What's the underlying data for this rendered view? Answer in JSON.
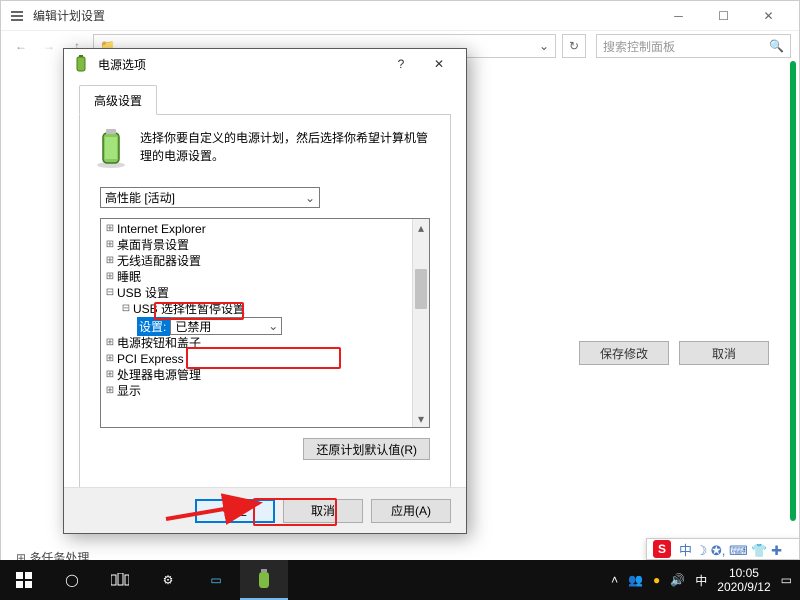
{
  "parent": {
    "title": "编辑计划设置",
    "search_placeholder": "搜索控制面板",
    "save_btn": "保存修改",
    "cancel_btn": "取消",
    "bottom_item": "多任务处理"
  },
  "dialog": {
    "title": "电源选项",
    "tab": "高级设置",
    "description": "选择你要自定义的电源计划，然后选择你希望计算机管理的电源设置。",
    "plan": "高性能 [活动]",
    "tree": {
      "items": [
        {
          "label": "Internet Explorer",
          "exp": "+",
          "lvl": 0
        },
        {
          "label": "桌面背景设置",
          "exp": "+",
          "lvl": 0
        },
        {
          "label": "无线适配器设置",
          "exp": "+",
          "lvl": 0
        },
        {
          "label": "睡眠",
          "exp": "+",
          "lvl": 0
        },
        {
          "label": "USB 设置",
          "exp": "−",
          "lvl": 0
        },
        {
          "label": "USB 选择性暂停设置",
          "exp": "−",
          "lvl": 1
        },
        {
          "label": "电源按钮和盖子",
          "exp": "+",
          "lvl": 0
        },
        {
          "label": "PCI Express",
          "exp": "+",
          "lvl": 0
        },
        {
          "label": "处理器电源管理",
          "exp": "+",
          "lvl": 0
        },
        {
          "label": "显示",
          "exp": "+",
          "lvl": 0
        }
      ],
      "setting_label": "设置:",
      "setting_value": "已禁用"
    },
    "restore_btn": "还原计划默认值(R)",
    "ok": "确定",
    "cancel": "取消",
    "apply": "应用(A)"
  },
  "taskbar": {
    "time": "10:05",
    "date": "2020/9/12",
    "lang": "中"
  },
  "ime": {
    "s": "S",
    "text": "中 ☽ ✪, ⌨  👕 ✚"
  }
}
